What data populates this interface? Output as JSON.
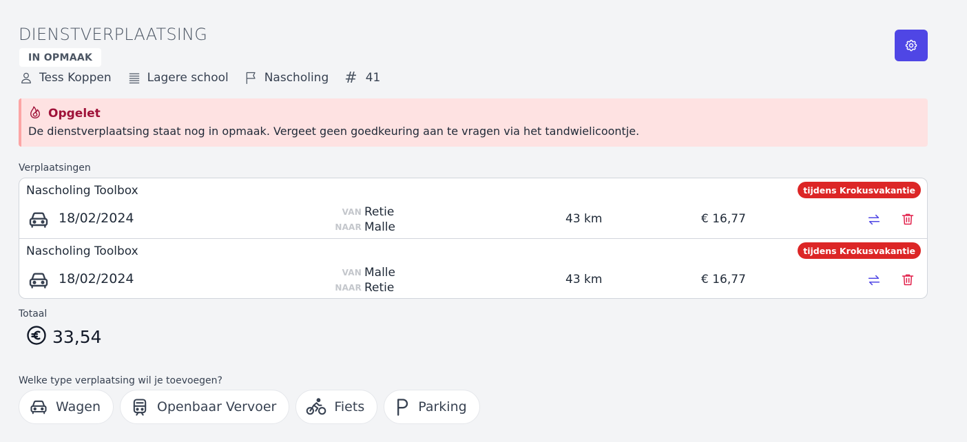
{
  "header": {
    "title": "DIENSTVERPLAATSING",
    "status": "IN OPMAAK"
  },
  "meta": {
    "person": "Tess Koppen",
    "school": "Lagere school",
    "category": "Nascholing",
    "number_prefix": "#",
    "number": "41"
  },
  "alert": {
    "title": "Opgelet",
    "message": "De dienstverplaatsing staat nog in opmaak. Vergeet geen goedkeuring aan te vragen via het tandwielicoontje."
  },
  "trips": {
    "label": "Verplaatsingen",
    "route_from_label": "VAN",
    "route_to_label": "NAAR",
    "items": [
      {
        "title": "Nascholing Toolbox",
        "badge": "tijdens Krokusvakantie",
        "date": "18/02/2024",
        "from": "Retie",
        "to": "Malle",
        "distance": "43 km",
        "cost": "€ 16,77"
      },
      {
        "title": "Nascholing Toolbox",
        "badge": "tijdens Krokusvakantie",
        "date": "18/02/2024",
        "from": "Malle",
        "to": "Retie",
        "distance": "43 km",
        "cost": "€ 16,77"
      }
    ]
  },
  "total": {
    "label": "Totaal",
    "value": "33,54"
  },
  "add": {
    "question": "Welke type verplaatsing wil je toevoegen?",
    "options": [
      {
        "label": "Wagen",
        "icon": "car-icon"
      },
      {
        "label": "Openbaar Vervoer",
        "icon": "train-icon"
      },
      {
        "label": "Fiets",
        "icon": "bicycle-icon"
      },
      {
        "label": "Parking",
        "icon": "parking-icon"
      }
    ]
  },
  "colors": {
    "accent": "#4f46e5",
    "danger": "#dc2626",
    "alert_bg": "#fee2e2",
    "alert_title": "#9f1239"
  }
}
